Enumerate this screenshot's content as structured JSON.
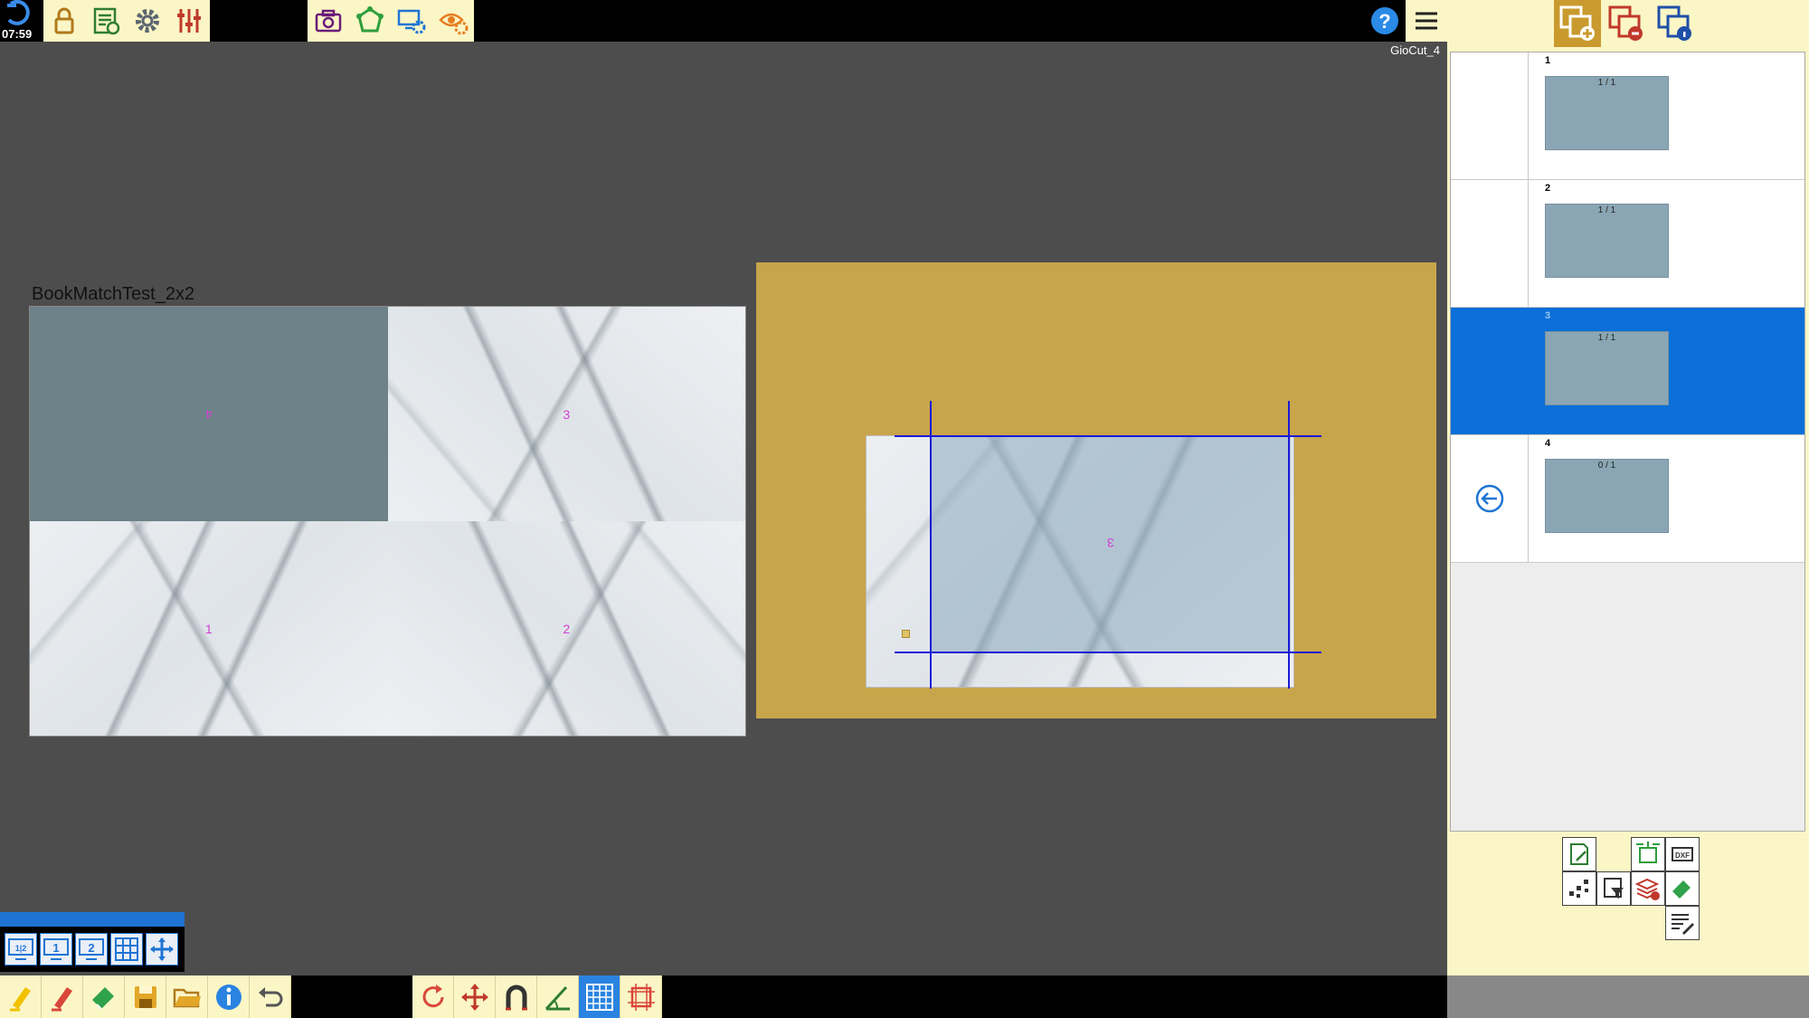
{
  "status": {
    "clock": "07:59",
    "machine_name": "GioCut_4"
  },
  "project": {
    "title": "BookMatchTest_2x2"
  },
  "layout": {
    "quadrants": [
      {
        "label": "4"
      },
      {
        "label": "3"
      },
      {
        "label": "1"
      },
      {
        "label": "2"
      }
    ]
  },
  "slab": {
    "piece_label": "3"
  },
  "pieces": [
    {
      "number": "1",
      "count": "1 / 1"
    },
    {
      "number": "2",
      "count": "1 / 1"
    },
    {
      "number": "3",
      "count": "1 / 1",
      "selected": true
    },
    {
      "number": "4",
      "count": "0 / 1"
    }
  ],
  "colors": {
    "accent": "#0a6fd8",
    "panel_bg": "#fbf6c6",
    "slab_bg": "#c8a54a",
    "cut_line": "#1a1ad6"
  },
  "icons": {
    "top_left": [
      "lock-icon",
      "job-report-icon",
      "settings-gear-icon",
      "sliders-icon"
    ],
    "top_middle": [
      "camera-icon",
      "shape-edit-icon",
      "screen-settings-icon",
      "eye-settings-icon"
    ],
    "top_right": [
      "help-icon",
      "menu-icon"
    ],
    "bottom": [
      "highlighter-icon",
      "marker-icon",
      "eraser-icon",
      "save-icon",
      "open-folder-icon",
      "info-icon",
      "undo-icon",
      "rotate-icon",
      "move-icon",
      "magnet-icon",
      "measure-angle-icon",
      "grid-icon",
      "fit-frame-icon"
    ]
  }
}
